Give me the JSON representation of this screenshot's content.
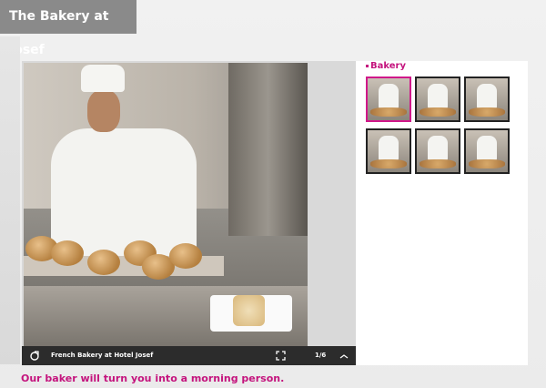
{
  "header": {
    "title": "The Bakery at Josef"
  },
  "viewer": {
    "caption": "French Bakery at Hotel Josef",
    "counter": "1/6",
    "photo_alt": "Chef arranging bread rolls on a tray"
  },
  "thumbnails": {
    "section_title": "Bakery",
    "items": [
      {
        "label": "Bakery photo 1",
        "active": true
      },
      {
        "label": "Bakery photo 2",
        "active": false
      },
      {
        "label": "Bakery photo 3",
        "active": false
      },
      {
        "label": "Bakery photo 4",
        "active": false
      },
      {
        "label": "Bakery photo 5",
        "active": false
      },
      {
        "label": "Bakery photo 6",
        "active": false
      }
    ]
  },
  "tagline": "Our baker will turn you into a morning person.",
  "colors": {
    "accent": "#c4137d",
    "header_bg": "#8a8a8a",
    "bar_bg": "#2c2c2c"
  },
  "icons": {
    "share": "share-icon",
    "fullscreen": "fullscreen-icon",
    "menu": "menu-toggle-icon"
  }
}
